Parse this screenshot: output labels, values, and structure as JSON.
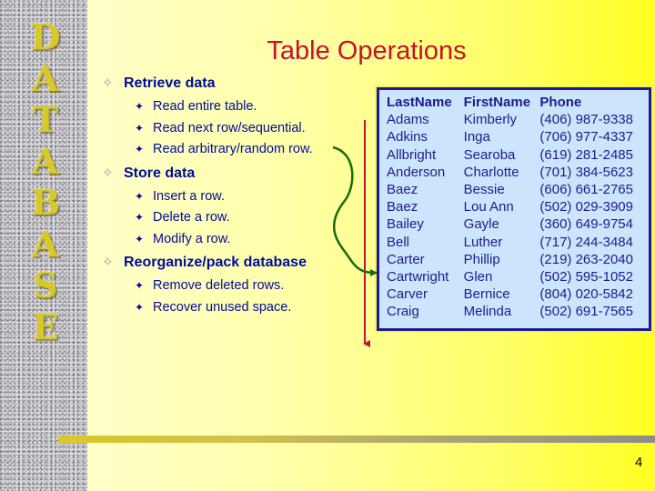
{
  "sidebar": {
    "letters": [
      "D",
      "A",
      "T",
      "A",
      "B",
      "A",
      "S",
      "E"
    ]
  },
  "slide": {
    "title": "Table Operations",
    "page_number": "4"
  },
  "outline": [
    {
      "label": "Retrieve data",
      "items": [
        "Read entire table.",
        "Read next row/sequential.",
        "Read arbitrary/random row."
      ]
    },
    {
      "label": "Store data",
      "items": [
        "Insert a row.",
        "Delete a row.",
        "Modify a row."
      ]
    },
    {
      "label": "Reorganize/pack database",
      "items": [
        "Remove deleted rows.",
        "Recover unused space."
      ]
    }
  ],
  "bullets": {
    "level1": "✧",
    "level2": "✦"
  },
  "table": {
    "headers": [
      "LastName",
      "FirstName",
      "Phone"
    ],
    "rows": [
      [
        "Adams",
        "Kimberly",
        "(406) 987-9338"
      ],
      [
        "Adkins",
        "Inga",
        "(706) 977-4337"
      ],
      [
        "Allbright",
        "Searoba",
        "(619) 281-2485"
      ],
      [
        "Anderson",
        "Charlotte",
        "(701) 384-5623"
      ],
      [
        "Baez",
        "Bessie",
        "(606) 661-2765"
      ],
      [
        "Baez",
        "Lou Ann",
        "(502) 029-3909"
      ],
      [
        "Bailey",
        "Gayle",
        "(360) 649-9754"
      ],
      [
        "Bell",
        "Luther",
        "(717) 244-3484"
      ],
      [
        "Carter",
        "Phillip",
        "(219) 263-2040"
      ],
      [
        "Cartwright",
        "Glen",
        "(502) 595-1052"
      ],
      [
        "Carver",
        "Bernice",
        "(804) 020-5842"
      ],
      [
        "Craig",
        "Melinda",
        "(502) 691-7565"
      ]
    ]
  },
  "colors": {
    "title": "#c8102e",
    "outline_text": "#000c9c",
    "table_bg": "#cce4fc",
    "table_border": "#1c1c8c",
    "sequential_arrow": "#c8103c",
    "random_arrow": "#1a6a10",
    "sidebar_letters": "#d8c828"
  }
}
